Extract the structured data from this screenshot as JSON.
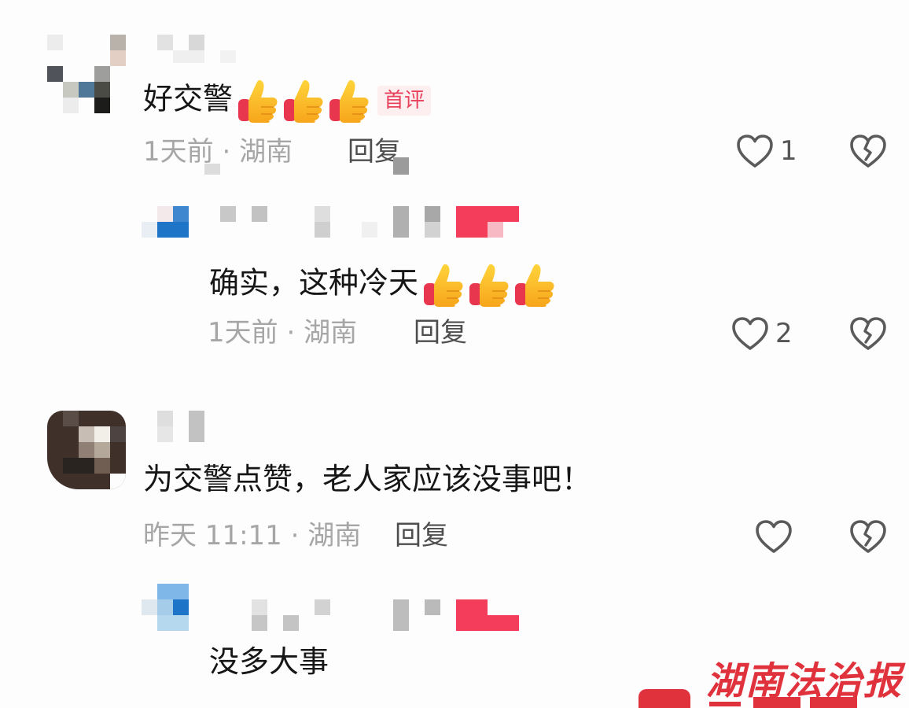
{
  "comments": [
    {
      "text": "好交警",
      "badge": "首评",
      "time": "1天前",
      "sep": "·",
      "region": "湖南",
      "reply_label": "回复",
      "like_count": "1",
      "thumbs": 3
    },
    {
      "text": "确实，这种冷天",
      "time": "1天前",
      "sep": "·",
      "region": "湖南",
      "reply_label": "回复",
      "like_count": "2",
      "thumbs": 3
    },
    {
      "text": "为交警点赞，老人家应该没事吧！",
      "time": "昨天 11:11",
      "sep": "·",
      "region": "湖南",
      "reply_label": "回复",
      "like_count": ""
    },
    {
      "text": "没多大事"
    }
  ],
  "watermark": {
    "text": "湖南法治报",
    "color": "#e0323c"
  },
  "icons": {
    "like": "heart-icon",
    "dislike": "broken-heart-icon",
    "emoji": "thumbs-up-emoji"
  },
  "colors": {
    "text": "#161616",
    "meta": "#a6a6a6",
    "badge_text": "#e8425d",
    "badge_bg": "#fdeef0",
    "blur_pink": "#f33d5b"
  }
}
